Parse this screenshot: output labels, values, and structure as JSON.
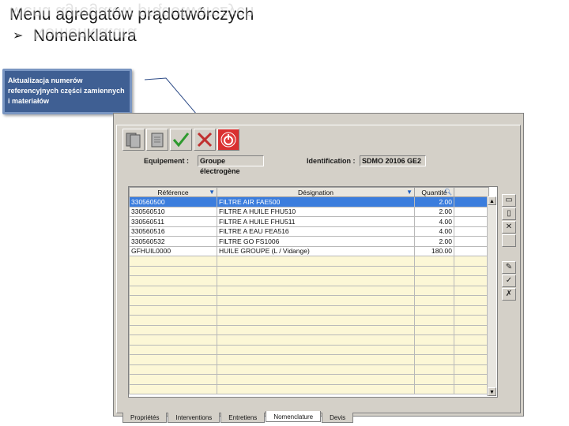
{
  "slide": {
    "title": "Menu agregatów prądotwórczych",
    "bullet": "Nomenklatura",
    "bullet_marker": "➢"
  },
  "callout": {
    "text": "Aktualizacja numerów referencyjnych części zamiennych i materiałów"
  },
  "toolbar": {
    "buttons": [
      {
        "icon": "copy-page-icon"
      },
      {
        "icon": "page-icon"
      },
      {
        "icon": "checkmark-icon",
        "color": "#2e9a2e"
      },
      {
        "icon": "cross-icon",
        "color": "#c0302f"
      },
      {
        "icon": "power-icon",
        "color": "#cc1f1f"
      }
    ]
  },
  "info": {
    "equipment_label": "Equipement :",
    "equipment_value": "Groupe électrogène",
    "identification_label": "Identification :",
    "identification_value": "SDMO 20106 GE2"
  },
  "grid": {
    "headers": {
      "reference": "Référence",
      "designation": "Désignation",
      "quantite": "Quantité"
    },
    "rows": [
      {
        "reference": "330560500",
        "designation": "FILTRE AIR FAE500",
        "quantite": "2.00"
      },
      {
        "reference": "330560510",
        "designation": "FILTRE A HUILE FHU510",
        "quantite": "2.00"
      },
      {
        "reference": "330560511",
        "designation": "FILTRE A HUILE FHU511",
        "quantite": "4.00"
      },
      {
        "reference": "330560516",
        "designation": "FILTRE A EAU FEA516",
        "quantite": "4.00"
      },
      {
        "reference": "330560532",
        "designation": "FILTRE GO FS1006",
        "quantite": "2.00"
      },
      {
        "reference": "GFHUIL0000",
        "designation": "HUILE GROUPE (L / Vidange)",
        "quantite": "180.00"
      }
    ],
    "selected_row": 0,
    "empty_rows": 14
  },
  "side_tools": [
    {
      "icon": "new-doc-icon",
      "glyph": "▭"
    },
    {
      "icon": "doc-icon",
      "glyph": "▯"
    },
    {
      "icon": "delete-x-icon",
      "glyph": "✕"
    },
    {
      "icon": "blank-icon",
      "glyph": ""
    },
    {
      "icon": "eraser-icon",
      "glyph": "✎"
    },
    {
      "icon": "validate-icon",
      "glyph": "✓"
    },
    {
      "icon": "cancel-icon",
      "glyph": "✗"
    }
  ],
  "tabs": [
    {
      "label": "Propriétés",
      "active": false
    },
    {
      "label": "Interventions",
      "active": false
    },
    {
      "label": "Entretiens",
      "active": false
    },
    {
      "label": "Nomenclature",
      "active": true
    },
    {
      "label": "Devis",
      "active": false
    }
  ],
  "colors": {
    "callout_bg": "#3f5f93",
    "selection": "#3b7ddd",
    "empty_row": "#fcf7d6"
  }
}
